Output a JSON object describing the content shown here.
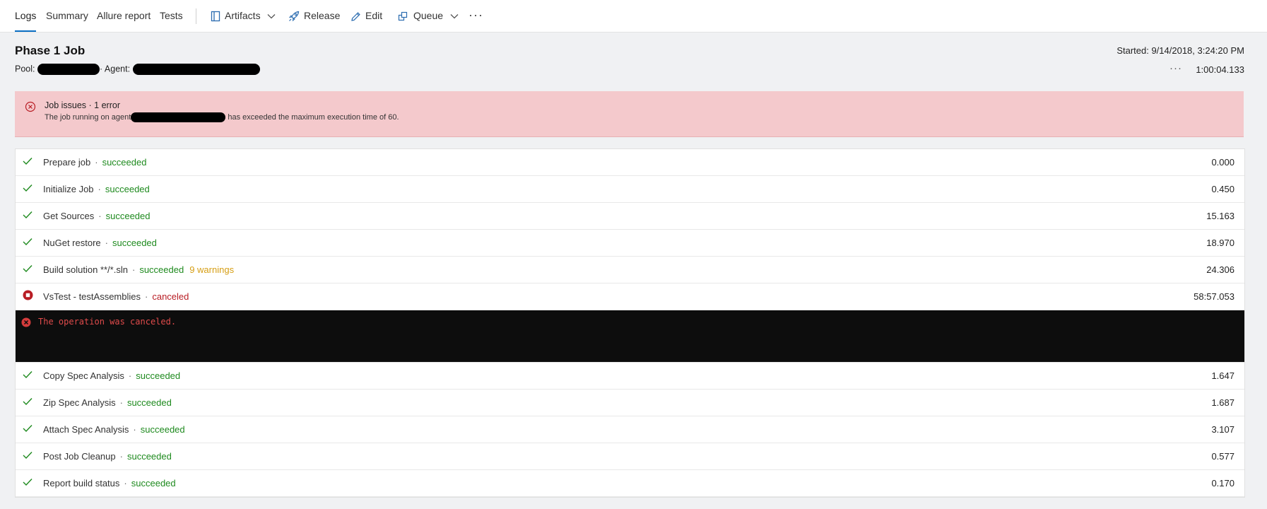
{
  "tabs": [
    {
      "label": "Logs",
      "active": true
    },
    {
      "label": "Summary",
      "active": false
    },
    {
      "label": "Allure report",
      "active": false
    },
    {
      "label": "Tests",
      "active": false
    }
  ],
  "toolbar": {
    "artifacts": "Artifacts",
    "release": "Release",
    "edit": "Edit",
    "queue": "Queue",
    "more": "···"
  },
  "job": {
    "title": "Phase 1 Job",
    "pool_label": "Pool:",
    "agent_label": "· Agent:",
    "started": "Started: 9/14/2018, 3:24:20 PM",
    "more": "···",
    "duration": "1:00:04.133"
  },
  "issues": {
    "title": "Job issues · 1 error",
    "message_prefix": "The job running on agent",
    "message_suffix": "has exceeded the maximum execution time of 60."
  },
  "steps": [
    {
      "name": "Prepare job",
      "status": "succeeded",
      "warnings": "",
      "time": "0.000"
    },
    {
      "name": "Initialize Job",
      "status": "succeeded",
      "warnings": "",
      "time": "0.450"
    },
    {
      "name": "Get Sources",
      "status": "succeeded",
      "warnings": "",
      "time": "15.163"
    },
    {
      "name": "NuGet restore",
      "status": "succeeded",
      "warnings": "",
      "time": "18.970"
    },
    {
      "name": "Build solution **/*.sln",
      "status": "succeeded",
      "warnings": "9 warnings",
      "time": "24.306"
    },
    {
      "name": "VsTest - testAssemblies",
      "status": "canceled",
      "warnings": "",
      "time": "58:57.053"
    },
    {
      "name": "Copy Spec Analysis",
      "status": "succeeded",
      "warnings": "",
      "time": "1.647"
    },
    {
      "name": "Zip Spec Analysis",
      "status": "succeeded",
      "warnings": "",
      "time": "1.687"
    },
    {
      "name": "Attach Spec Analysis",
      "status": "succeeded",
      "warnings": "",
      "time": "3.107"
    },
    {
      "name": "Post Job Cleanup",
      "status": "succeeded",
      "warnings": "",
      "time": "0.577"
    },
    {
      "name": "Report build status",
      "status": "succeeded",
      "warnings": "",
      "time": "0.170"
    }
  ],
  "console": {
    "message": "The operation was canceled."
  },
  "colors": {
    "accent": "#0b6fc4",
    "success": "#1e8a1e",
    "error": "#b81d24",
    "warning": "#d69e14",
    "issue_bg": "#f4c9cc"
  }
}
